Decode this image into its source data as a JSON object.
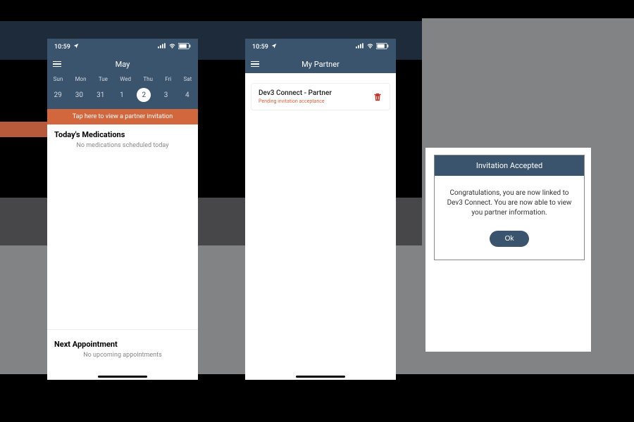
{
  "status": {
    "time": "10:59",
    "signal": "••••",
    "wifi": "wifi",
    "battery": "80%"
  },
  "phone1": {
    "month": "May",
    "weekdays": [
      "Sun",
      "Mon",
      "Tue",
      "Wed",
      "Thu",
      "Fri",
      "Sat"
    ],
    "days": [
      "29",
      "30",
      "31",
      "1",
      "2",
      "3",
      "4"
    ],
    "selected_index": 4,
    "banner": "Tap here to view a partner invitation",
    "meds_title": "Today's Medications",
    "meds_empty": "No medications scheduled today",
    "appt_title": "Next Appointment",
    "appt_empty": "No upcoming appointments"
  },
  "phone2": {
    "title": "My Partner",
    "partner_name": "Dev3 Connect - Partner",
    "partner_status": "Pending invitation acceptance"
  },
  "dialog": {
    "title": "Invitation Accepted",
    "body": "Congratulations, you are now linked to Dev3 Connect. You are now able to view you partner information.",
    "ok": "Ok"
  }
}
